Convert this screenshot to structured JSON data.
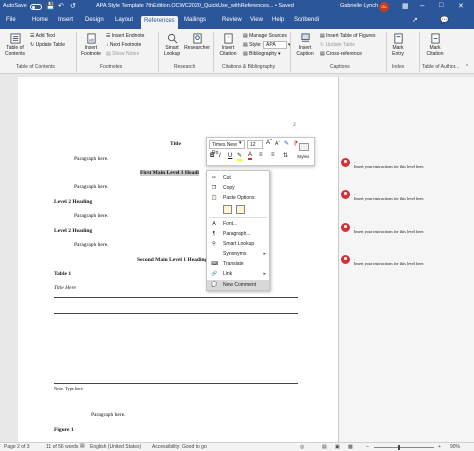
{
  "titlebar": {
    "autosave": "AutoSave",
    "toggle_state": "Off",
    "doc_title": "APA Style Template 7thEdition.OCWC2020_QuickUse_withReferences... • Saved",
    "user": "Gabrielle Lynch",
    "user_initials": "GL"
  },
  "tabs": [
    "File",
    "Home",
    "Insert",
    "Design",
    "Layout",
    "References",
    "Mailings",
    "Review",
    "View",
    "Help",
    "Scribendi"
  ],
  "active_tab": "References",
  "ribbon": {
    "toc": "Table of Contents",
    "add_text": "Add Text",
    "update_table": "Update Table",
    "insert_footnote": "Insert Footnote",
    "insert_endnote": "Insert Endnote",
    "next_footnote": "Next Footnote",
    "show_notes": "Show Notes",
    "smart_lookup": "Smart Lookup",
    "researcher": "Researcher",
    "insert_citation": "Insert Citation",
    "manage_sources": "Manage Sources",
    "style_label": "Style:",
    "style_value": "APA",
    "bibliography": "Bibliography",
    "insert_caption": "Insert Caption",
    "insert_table_of_figures": "Insert Table of Figures",
    "update_table_fig": "Update Table",
    "cross_reference": "Cross-reference",
    "mark_entry": "Mark Entry",
    "mark_citation": "Mark Citation",
    "groups": [
      "Table of Contents",
      "Footnotes",
      "Research",
      "Citations & Bibliography",
      "Captions",
      "Index",
      "Table of Author..."
    ]
  },
  "document": {
    "page_number": "2",
    "title": "Title",
    "para1": "Paragraph here.",
    "first_main": "First Main Level 1 Headi",
    "para2": "Paragraph here.",
    "level2a": "Level 2 Heading",
    "para3": "Paragraph here.",
    "level2b": "Level 2 Heading",
    "para4": "Paragraph here.",
    "second_main": "Second Main Level 1 Heading",
    "table_label": "Table 1",
    "table_title": "Title Here",
    "note": "Note. Type here.",
    "para5": "Paragraph here.",
    "figure_label": "Figure 1"
  },
  "comments": [
    {
      "author": "-",
      "text": "Insert your instructions for this level here."
    },
    {
      "author": "-",
      "text": "Insert your instructions for this level here."
    },
    {
      "author": "-",
      "text": "Insert your instructions for this level here."
    },
    {
      "author": "-",
      "text": "Insert your instructions for this level here."
    }
  ],
  "minitoolbar": {
    "font": "Times New Ro",
    "size": "12",
    "bold": "B",
    "italic": "I",
    "underline": "U",
    "styles": "Styles"
  },
  "context_menu": {
    "cut": "Cut",
    "copy": "Copy",
    "paste_options": "Paste Options:",
    "font": "Font...",
    "paragraph": "Paragraph...",
    "smart_lookup": "Smart Lookup",
    "synonyms": "Synonyms",
    "translate": "Translate",
    "link": "Link",
    "new_comment": "New Comment"
  },
  "statusbar": {
    "page": "Page 2 of 3",
    "words": "11 of 56 words",
    "language": "English (United States)",
    "accessibility": "Accessibility: Good to go",
    "zoom": "90%"
  },
  "colors": {
    "accent": "#2b579a",
    "comment_red": "#d13438"
  }
}
